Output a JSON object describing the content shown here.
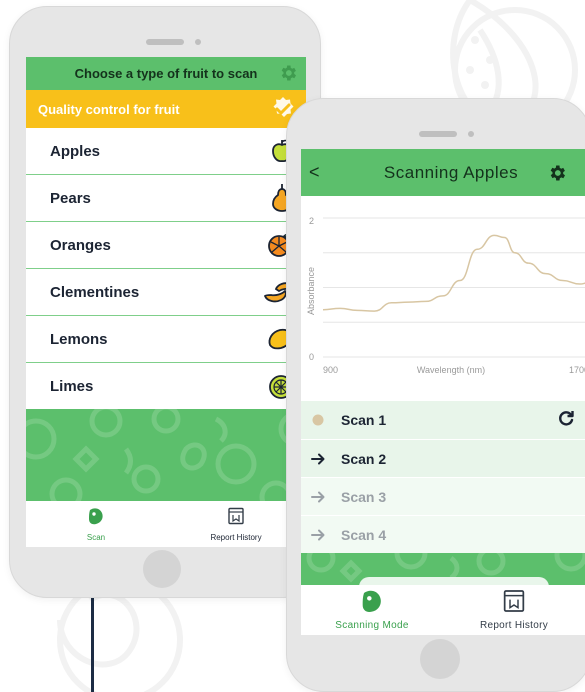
{
  "left_phone": {
    "header_title": "Choose a type of fruit to scan",
    "banner_text": "Quality control for fruit",
    "fruits": [
      {
        "label": "Apples",
        "icon": "apple-icon"
      },
      {
        "label": "Pears",
        "icon": "pear-icon"
      },
      {
        "label": "Oranges",
        "icon": "orange-slice-icon"
      },
      {
        "label": "Clementines",
        "icon": "clementine-icon"
      },
      {
        "label": "Lemons",
        "icon": "lemon-icon"
      },
      {
        "label": "Limes",
        "icon": "lime-icon"
      }
    ],
    "tabs": [
      {
        "label": "Scan",
        "icon": "scanner-icon",
        "active": true
      },
      {
        "label": "Report History",
        "icon": "report-icon",
        "active": false
      }
    ]
  },
  "right_phone": {
    "header_title": "Scanning Apples",
    "back_label": "<",
    "scans": [
      {
        "label": "Scan 1",
        "state": "completed"
      },
      {
        "label": "Scan 2",
        "state": "next"
      },
      {
        "label": "Scan 3",
        "state": "pending"
      },
      {
        "label": "Scan 4",
        "state": "pending"
      }
    ],
    "tabs": [
      {
        "label": "Scanning Mode",
        "icon": "scanner-icon",
        "active": true
      },
      {
        "label": "Report History",
        "icon": "report-icon",
        "active": false
      }
    ]
  },
  "chart_data": {
    "type": "line",
    "title": "",
    "xlabel": "Wavelength (nm)",
    "ylabel": "Absorbance",
    "x_ticks": [
      "900",
      "1700"
    ],
    "y_ticks": [
      "0",
      "2"
    ],
    "xlim": [
      900,
      1700
    ],
    "ylim": [
      0,
      2
    ],
    "grid": true,
    "series": [
      {
        "color": "#d8c6a3",
        "x": [
          900,
          950,
          1000,
          1050,
          1100,
          1150,
          1200,
          1250,
          1300,
          1350,
          1400,
          1430,
          1460,
          1500,
          1550,
          1600,
          1650,
          1700
        ],
        "y": [
          0.68,
          0.7,
          0.67,
          0.66,
          0.78,
          0.79,
          0.8,
          0.88,
          1.1,
          1.55,
          1.75,
          1.72,
          1.5,
          1.35,
          1.2,
          1.1,
          1.05,
          1.12
        ]
      }
    ]
  },
  "colors": {
    "brand_green": "#5cbf6c",
    "banner_yellow": "#f8c01a",
    "text_dark": "#1c2433",
    "scan_dot": "#d8c6a3"
  }
}
